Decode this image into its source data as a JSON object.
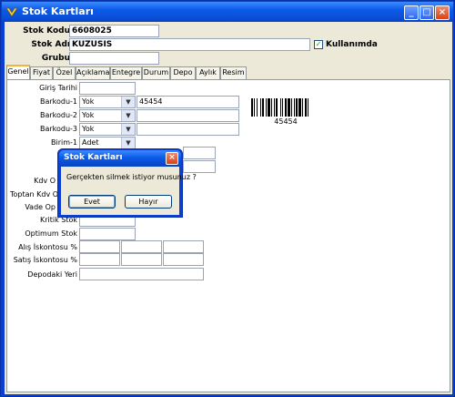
{
  "window": {
    "title": "Stok Kartları"
  },
  "header": {
    "stok_kodu_label": "Stok Kodu",
    "stok_kodu_value": "6608025",
    "stok_adi_label": "Stok Adı",
    "stok_adi_value": "KUZUSIS",
    "grubu_label": "Grubu",
    "grubu_value": "",
    "kullanimda_label": "Kullanımda",
    "kullanimda_checked": true
  },
  "tabs": [
    "Genel",
    "Fiyat",
    "Özel",
    "Açıklama",
    "Entegre",
    "Durum",
    "Depo",
    "Aylık",
    "Resim"
  ],
  "form": {
    "giris_tarihi": "Giriş Tarihi",
    "barkod1_label": "Barkodu-1",
    "barkod1_combo": "Yok",
    "barkod1_value": "45454",
    "barkod2_label": "Barkodu-2",
    "barkod2_combo": "Yok",
    "barkod3_label": "Barkodu-3",
    "barkod3_combo": "Yok",
    "birim1_label": "Birim-1",
    "birim1_combo": "Adet",
    "kdv_label": "Kdv O",
    "toptan_kdv_label": "Toptan Kdv O",
    "vade_label": "Vade Op",
    "kritik_stok_label": "Kritik Stok",
    "optimum_stok_label": "Optimum Stok",
    "alis_iskontosu_label": "Alış İskontosu %",
    "satis_iskontosu_label": "Satış İskontosu %",
    "depodaki_yeri_label": "Depodaki Yeri",
    "barcode_text": "45454"
  },
  "dialog": {
    "title": "Stok Kartları",
    "message": "Gerçekten silmek istiyor musunuz ?",
    "yes_label": "Evet",
    "no_label": "Hayır"
  },
  "colors": {
    "titlebar": "#0b5be8",
    "client_bg": "#ece9d8",
    "tab_accent": "#f2b438"
  }
}
